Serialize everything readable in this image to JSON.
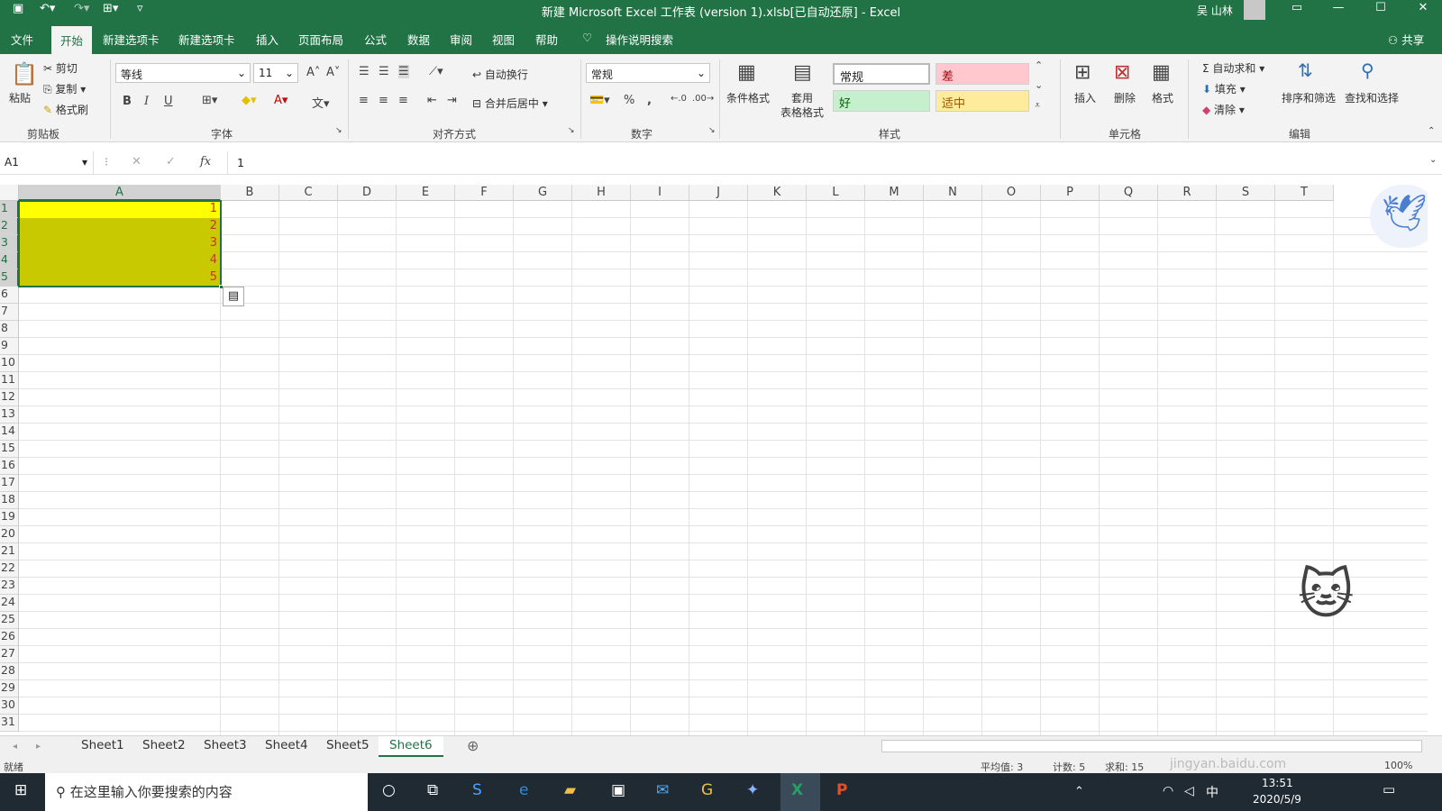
{
  "window": {
    "title": "新建 Microsoft Excel 工作表 (version 1).xlsb[已自动还原]  -  Excel",
    "user": "吴 山林"
  },
  "menu": {
    "file": "文件",
    "home": "开始",
    "tabs": [
      "新建选项卡",
      "新建选项卡",
      "插入",
      "页面布局",
      "公式",
      "数据",
      "审阅",
      "视图",
      "帮助"
    ],
    "tell_me": "操作说明搜索",
    "share": "共享"
  },
  "ribbon": {
    "clipboard": {
      "paste": "粘贴",
      "cut": "剪切",
      "copy": "复制",
      "format_painter": "格式刷",
      "label": "剪贴板"
    },
    "font": {
      "name": "等线",
      "size": "11",
      "bold": "B",
      "italic": "I",
      "underline": "U",
      "label": "字体"
    },
    "align": {
      "wrap": "自动换行",
      "merge": "合并后居中",
      "label": "对齐方式"
    },
    "number": {
      "format": "常规",
      "percent": "%",
      "comma": ",",
      "label": "数字"
    },
    "styles": {
      "cond_format": "条件格式",
      "table_format_1": "套用",
      "table_format_2": "表格格式",
      "normal": "常规",
      "bad": "差",
      "good": "好",
      "neutral": "适中",
      "label": "样式"
    },
    "cells": {
      "insert": "插入",
      "delete": "删除",
      "format": "格式",
      "label": "单元格"
    },
    "editing": {
      "autosum": "自动求和",
      "fill": "填充",
      "clear": "清除",
      "sort": "排序和筛选",
      "find": "查找和选择",
      "label": "编辑"
    }
  },
  "formula_bar": {
    "name_box": "A1",
    "fx": "fx",
    "value": "1"
  },
  "grid": {
    "columns": [
      "A",
      "B",
      "C",
      "D",
      "E",
      "F",
      "G",
      "H",
      "I",
      "J",
      "K",
      "L",
      "M",
      "N",
      "O",
      "P",
      "Q",
      "R",
      "S",
      "T"
    ],
    "rows": [
      "1",
      "2",
      "3",
      "4",
      "5",
      "6",
      "7",
      "8",
      "9",
      "10",
      "11",
      "12",
      "13",
      "14",
      "15",
      "16",
      "17",
      "18",
      "19",
      "20",
      "21",
      "22",
      "23",
      "24",
      "25",
      "26",
      "27",
      "28",
      "29",
      "30",
      "31"
    ],
    "a_values": [
      "1",
      "2",
      "3",
      "4",
      "5"
    ]
  },
  "sheets": {
    "tabs": [
      "Sheet1",
      "Sheet2",
      "Sheet3",
      "Sheet4",
      "Sheet5",
      "Sheet6"
    ],
    "active": "Sheet6"
  },
  "status": {
    "ready": "就绪",
    "average": "平均值: 3",
    "count": "计数: 5",
    "sum": "求和: 15",
    "zoom": "100%",
    "watermark": "jingyan.baidu.com"
  },
  "taskbar": {
    "search": "在这里输入你要搜索的内容",
    "time": "13:51",
    "date": "2020/5/9",
    "ime": "中"
  },
  "colors": {
    "excel_green": "#217346",
    "selection_fill": "#c9c900",
    "first_cell_fill": "#ffff00",
    "cell_text": "#c0392b"
  }
}
